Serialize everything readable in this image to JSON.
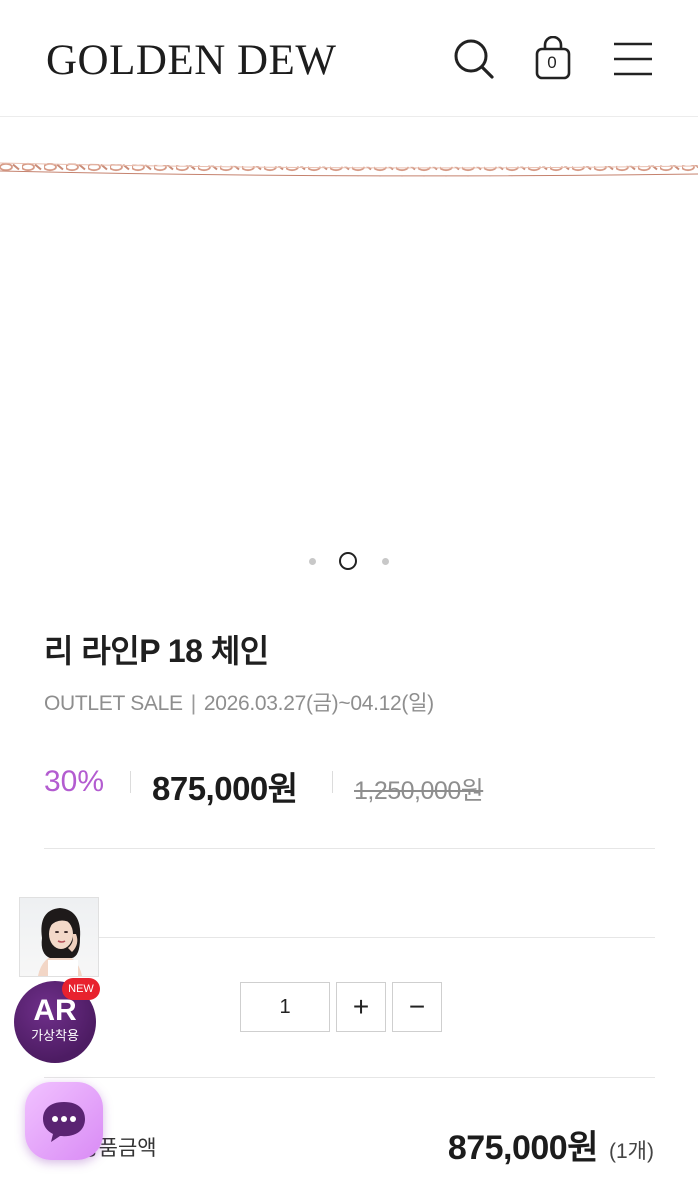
{
  "header": {
    "logo": "GOLDEN DEW",
    "cart_count": "0"
  },
  "gallery": {
    "slide_count": 3,
    "active_index": 1
  },
  "product": {
    "title": "리 라인P 18 체인",
    "sale_name": "OUTLET SALE",
    "sale_separator": "|",
    "sale_period": "2026.03.27(금)~04.12(일)",
    "discount": "30%",
    "price": "875,000원",
    "original_price": "1,250,000원"
  },
  "quantity": {
    "value": "1",
    "plus": "+",
    "minus": "−"
  },
  "total": {
    "label": "총상품금액",
    "amount": "875,000원",
    "count": "(1개)"
  },
  "floating": {
    "ar_title": "AR",
    "ar_subtitle": "가상착용",
    "new_tag": "NEW"
  },
  "colors": {
    "accent": "#b35cd0",
    "chain": "#d9a08c",
    "ar_badge": "#5a2472",
    "new_tag": "#e8222e",
    "chat": "#e2a2f7"
  },
  "icons": {
    "search": "search-icon",
    "cart": "shopping-bag-icon",
    "menu": "hamburger-menu-icon",
    "chat": "chat-bubble-icon"
  }
}
